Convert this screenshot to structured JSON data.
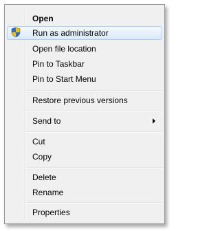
{
  "menu": {
    "items": [
      {
        "label": "Open"
      },
      {
        "label": "Run as administrator",
        "icon": "uac-shield-icon"
      },
      {
        "label": "Open file location"
      },
      {
        "label": "Pin to Taskbar"
      },
      {
        "label": "Pin to Start Menu"
      },
      {
        "label": "Restore previous versions"
      },
      {
        "label": "Send to"
      },
      {
        "label": "Cut"
      },
      {
        "label": "Copy"
      },
      {
        "label": "Delete"
      },
      {
        "label": "Rename"
      },
      {
        "label": "Properties"
      }
    ]
  },
  "colors": {
    "menu_background": "#f0f0f0",
    "hover_border": "#aecff7",
    "hover_fill": "#dbeaf8"
  }
}
